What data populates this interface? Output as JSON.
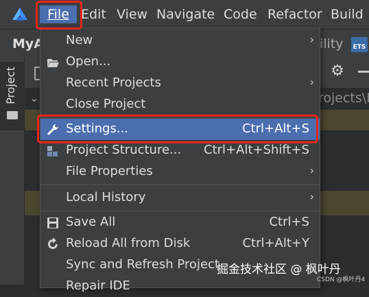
{
  "menubar": {
    "items": [
      "File",
      "Edit",
      "View",
      "Navigate",
      "Code",
      "Refactor",
      "Build"
    ]
  },
  "nav": {
    "project": "MyA",
    "right_text": "ility",
    "ets_badge": "ETS",
    "path_text": "rojects\\M"
  },
  "sidebar": {
    "project_tab": "Project"
  },
  "file_menu": {
    "items": [
      {
        "label": "New",
        "shortcut": "",
        "submenu": true,
        "icon": ""
      },
      {
        "label": "Open...",
        "shortcut": "",
        "submenu": false,
        "icon": "folder-open-icon"
      },
      {
        "label": "Recent Projects",
        "shortcut": "",
        "submenu": true,
        "icon": ""
      },
      {
        "label": "Close Project",
        "shortcut": "",
        "submenu": false,
        "icon": ""
      },
      {
        "label": "Settings...",
        "shortcut": "Ctrl+Alt+S",
        "submenu": false,
        "icon": "wrench-icon",
        "selected": true
      },
      {
        "label": "Project Structure...",
        "shortcut": "Ctrl+Alt+Shift+S",
        "submenu": false,
        "icon": "project-structure-icon"
      },
      {
        "label": "File Properties",
        "shortcut": "",
        "submenu": true,
        "icon": ""
      },
      {
        "label": "Local History",
        "shortcut": "",
        "submenu": true,
        "icon": ""
      },
      {
        "label": "Save All",
        "shortcut": "Ctrl+S",
        "submenu": false,
        "icon": "save-icon"
      },
      {
        "label": "Reload All from Disk",
        "shortcut": "Ctrl+Alt+Y",
        "submenu": false,
        "icon": "reload-icon"
      },
      {
        "label": "Sync and Refresh Project",
        "shortcut": "",
        "submenu": false,
        "icon": ""
      },
      {
        "label": "Repair IDE",
        "shortcut": "",
        "submenu": false,
        "icon": ""
      }
    ]
  },
  "watermark": {
    "text": "掘金技术社区 @ 枫叶丹",
    "small": "CSDN @枫叶丹4"
  },
  "colors": {
    "menubar_bg": "#3c3f41",
    "selected": "#4b6eaf",
    "highlight_box": "#e8261a"
  }
}
